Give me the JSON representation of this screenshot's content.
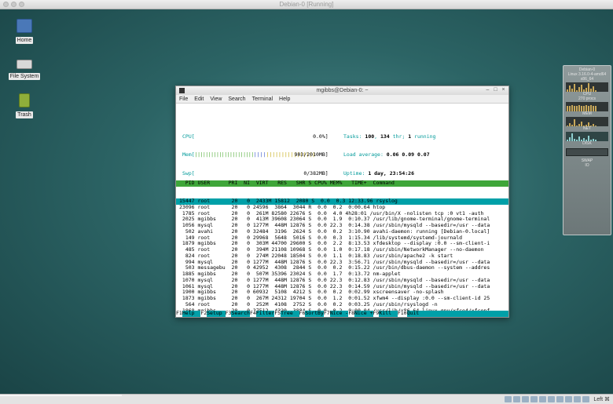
{
  "vbox": {
    "title": "Debian-0 [Running]",
    "host_key": "Left ⌘"
  },
  "desktop_icons": [
    {
      "label": "Home",
      "color": "#4a78b8"
    },
    {
      "label": "File System",
      "color": "#cfcfcf"
    },
    {
      "label": "Trash",
      "color": "#8fae3a"
    }
  ],
  "terminal": {
    "title": "mgibbs@Debian-0: ~",
    "controls": [
      "–",
      "□",
      "×"
    ],
    "menu": [
      "File",
      "Edit",
      "View",
      "Search",
      "Terminal",
      "Help"
    ]
  },
  "htop": {
    "cpu_label": "CPU[",
    "cpu_value": "0.0%]",
    "mem_label": "Mem[",
    "mem_value": "903/2010MB]",
    "swp_label": "Swp[",
    "swp_value": "0/382MB]",
    "tasks_prefix": "Tasks: ",
    "tasks_count": "100",
    "tasks_mid": ", ",
    "threads": "134",
    "tasks_thr": " thr; ",
    "running": "1",
    "tasks_running": " running",
    "load_label": "Load average: ",
    "load_1": "0.06",
    "load_5": "0.09",
    "load_15": "0.07",
    "uptime_label": "Uptime: ",
    "uptime": "1 day, 23:54:26",
    "header": "  PID USER      PRI  NI  VIRT   RES   SHR S CPU% MEM%   TIME+  Command",
    "rows": [
      "15447 root       20   0  2433M 15812  2080 S  0.0  0.3 12:33.96 rsyslog",
      "23096 root       20   0 24596  3864  3044 R  0.0  0.2  0:00.64 htop",
      " 1785 root       20   0  261M 82580 22676 S  0.0  4.0 4h28:01 /usr/bin/X -nolisten tcp :0 vt1 -auth",
      " 2025 mgibbs     20   0  413M 39608 23064 S  0.0  1.9  0:10.37 /usr/lib/gnome-terminal/gnome-terminal",
      " 1056 mysql      20   0 1277M  448M 12876 S  0.0 22.3  0:14.38 /usr/sbin/mysqld --basedir=/usr --data",
      "  502 avahi      20   0 32484  3196  2624 S  0.0  0.2  3:10.90 avahi-daemon: running [Debian-0.local]",
      "  149 root       20   0 29968  5648  5016 S  0.0  0.3  1:15.34 /lib/systemd/systemd-journald",
      " 1879 mgibbs     20   0  303M 44700 29600 S  0.0  2.2  8:13.53 xfdesktop --display :0.0 --sm-client-i",
      "  485 root       20   0  394M 21108 10968 S  0.0  1.0  0:17.18 /usr/sbin/NetworkManager --no-daemon",
      "  824 root       20   0  274M 22048 18504 S  0.0  1.1  0:18.83 /usr/sbin/apache2 -k start",
      "  994 mysql      20   0 1277M  448M 12876 S  0.0 22.3  3:56.71 /usr/sbin/mysqld --basedir=/usr --data",
      "  503 messagebu  20   0 42952  4308  2844 S  0.0  0.2  0:15.22 /usr/bin/dbus-daemon --system --addres",
      " 1885 mgibbs     20   0  507M 35396 23024 S  0.0  1.7  0:13.72 nm-applet",
      " 1070 mysql      20   0 1277M  448M 12876 S  0.0 22.3  0:12.83 /usr/sbin/mysqld --basedir=/usr --data",
      " 1061 mysql      20   0 1277M  448M 12876 S  0.0 22.3  0:14.59 /usr/sbin/mysqld --basedir=/usr --data",
      " 1900 mgibbs     20   0 60932  5108  4212 S  0.0  0.2  0:02.99 xscreensaver -no-splash",
      " 1873 mgibbs     20   0  267M 24312 19704 S  0.0  1.2  0:01.52 xfwm4 --display :0.0 --sm-client-id 25",
      "  564 root       20   0  252M  4108  2752 S  0.0  0.2  0:03.25 /usr/sbin/rsyslogd -n",
      " 1868 mgibbs     20   0 37512  4320  3884 S  0.0  0.2  0:00.04 /usr/lib/x86_64-linux-gnu/xfce4/xfconf",
      "  631 root       20   0  228M  1736  1440 S  0.0  0.1  0:23.53 /usr/sbin/VBoxService",
      "  643 root       20   0  252M  4108  2752 S  0.0  0.2  0:01.92 /usr/sbin/rsyslogd -n",
      "  625 root       20   0  228M  1736  1440 S  0.0  0.1  1:14.75 /usr/sbin/VBoxService",
      " 1058 mysql      20   0 1277M  448M 12876 S  0.0 22.3  0:14.92 /usr/sbin/mysqld --basedir=/usr --data",
      " 1943 mgibbs     20   0  122M  4984  4544 S  0.0  0.2  0:00.39 /usr/lib/at-spi2-core/at-spi2-registry",
      " 1877 mgibbs     20   0  778M 38876 22568 S  0.0  1.5  0:09.73 xfce4-panel --display :0.0 --sm-client",
      " 1075 mysql      20   0 1277M  448M 12876 S  0.0 22.3  0:39.86 /usr/sbin/mysqld --basedir=/usr --data"
    ],
    "fkeys": [
      {
        "key": "F1",
        "label": "Help  "
      },
      {
        "key": "F2",
        "label": "Setup "
      },
      {
        "key": "F3",
        "label": "Search"
      },
      {
        "key": "F4",
        "label": "Filter"
      },
      {
        "key": "F5",
        "label": "Tree  "
      },
      {
        "key": "F6",
        "label": "SortBy"
      },
      {
        "key": "F7",
        "label": "Nice -"
      },
      {
        "key": "F8",
        "label": "Nice +"
      },
      {
        "key": "F9",
        "label": "Kill  "
      },
      {
        "key": "F10",
        "label": "Quit"
      }
    ]
  },
  "monitor": {
    "lines": [
      "Debian-0",
      "Linux 3.16.0-4-amd64",
      "x86_64",
      "CPU",
      "270 procs",
      "MEM",
      "NET",
      "DISK",
      "SWAP",
      "IO"
    ]
  },
  "colors": {
    "desktop": "#2c6465",
    "htop_header": "#3fa63a",
    "htop_selected": "#00a0a8"
  }
}
